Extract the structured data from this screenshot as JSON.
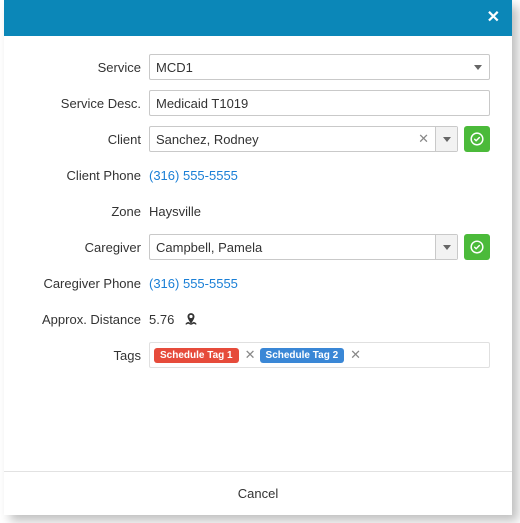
{
  "labels": {
    "service": "Service",
    "service_desc": "Service Desc.",
    "client": "Client",
    "client_phone": "Client Phone",
    "zone": "Zone",
    "caregiver": "Caregiver",
    "caregiver_phone": "Caregiver Phone",
    "approx_distance": "Approx. Distance",
    "tags": "Tags"
  },
  "values": {
    "service": "MCD1",
    "service_desc": "Medicaid T1019",
    "client": "Sanchez, Rodney",
    "client_phone": "(316) 555-5555",
    "zone": "Haysville",
    "caregiver": "Campbell, Pamela",
    "caregiver_phone": "(316) 555-5555",
    "approx_distance": "5.76"
  },
  "tags": {
    "t1": "Schedule Tag 1",
    "t2": "Schedule Tag 2"
  },
  "footer": {
    "cancel": "Cancel"
  }
}
